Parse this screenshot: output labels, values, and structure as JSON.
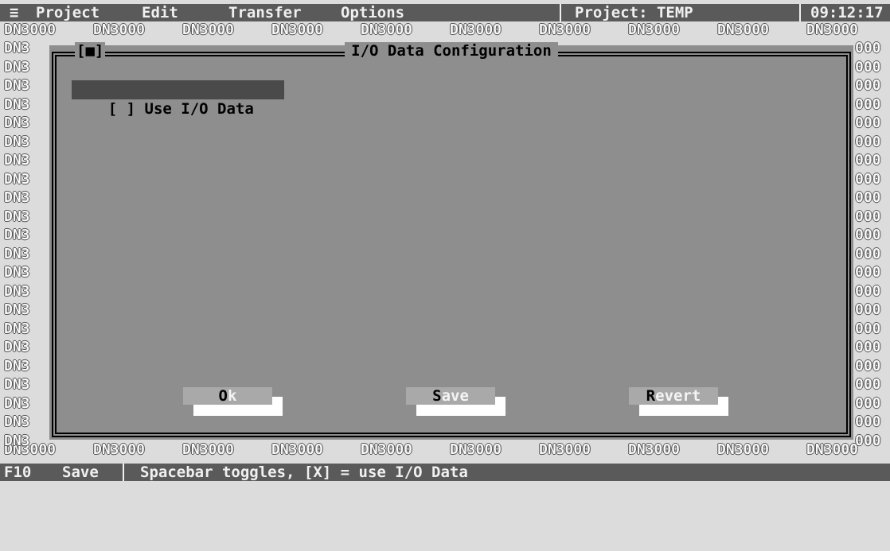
{
  "menubar": {
    "system_menu": "≡",
    "items": [
      "Project",
      "Edit",
      "Transfer",
      "Options"
    ],
    "project_status": "Project: TEMP",
    "clock": "09:12:17"
  },
  "background": {
    "tile_text": "DN3000",
    "left_edge_text": "DN3",
    "right_edge_text": "000"
  },
  "dialog": {
    "close_box": "[■]",
    "title": "I/O Data Configuration",
    "checkbox_label": "[ ] Use I/O Data",
    "checkbox_checked": false,
    "buttons": {
      "ok": {
        "accel": "O",
        "rest": "k"
      },
      "save": {
        "accel": "S",
        "rest": "ave"
      },
      "revert": {
        "accel": "R",
        "rest": "evert"
      }
    }
  },
  "statusbar": {
    "key": "F10",
    "key_action": "Save",
    "hint": "Spacebar toggles, [X] = use I/O Data"
  },
  "colors": {
    "bar": "#5a5a5a",
    "dialog": "#8e8e8e",
    "button_face": "#a9a9a9",
    "desktop": "#dcdcdc"
  }
}
